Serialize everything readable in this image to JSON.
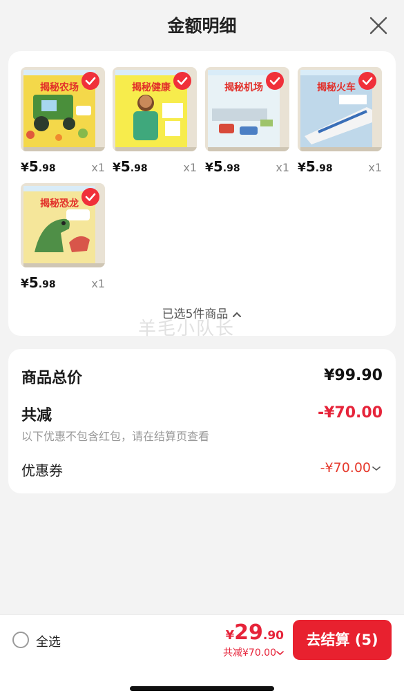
{
  "header": {
    "title": "金额明细"
  },
  "products": [
    {
      "cover_text": "揭秘农场",
      "price_currency": "¥",
      "price_int": "5",
      "price_dec": ".98",
      "qty": "x1"
    },
    {
      "cover_text": "揭秘健康",
      "price_currency": "¥",
      "price_int": "5",
      "price_dec": ".98",
      "qty": "x1"
    },
    {
      "cover_text": "揭秘机场",
      "price_currency": "¥",
      "price_int": "5",
      "price_dec": ".98",
      "qty": "x1"
    },
    {
      "cover_text": "揭秘火车",
      "price_currency": "¥",
      "price_int": "5",
      "price_dec": ".98",
      "qty": "x1"
    },
    {
      "cover_text": "揭秘恐龙",
      "price_currency": "¥",
      "price_int": "5",
      "price_dec": ".98",
      "qty": "x1"
    }
  ],
  "selected_summary": "已选5件商品",
  "watermark": "羊毛小队长",
  "summary": {
    "total_label": "商品总价",
    "total_value": "¥99.90",
    "reduction_label": "共减",
    "reduction_value": "-¥70.00",
    "note": "以下优惠不包含红包，请在结算页查看",
    "coupon_label": "优惠券",
    "coupon_value": "-¥70.00"
  },
  "bottom": {
    "select_all": "全选",
    "total_currency": "¥",
    "total_int": "29",
    "total_dec": ".90",
    "discount": "共减¥70.00",
    "checkout": "去结算 (5)"
  },
  "colors": {
    "accent": "#e8212f",
    "discount_red": "#e6243a"
  }
}
